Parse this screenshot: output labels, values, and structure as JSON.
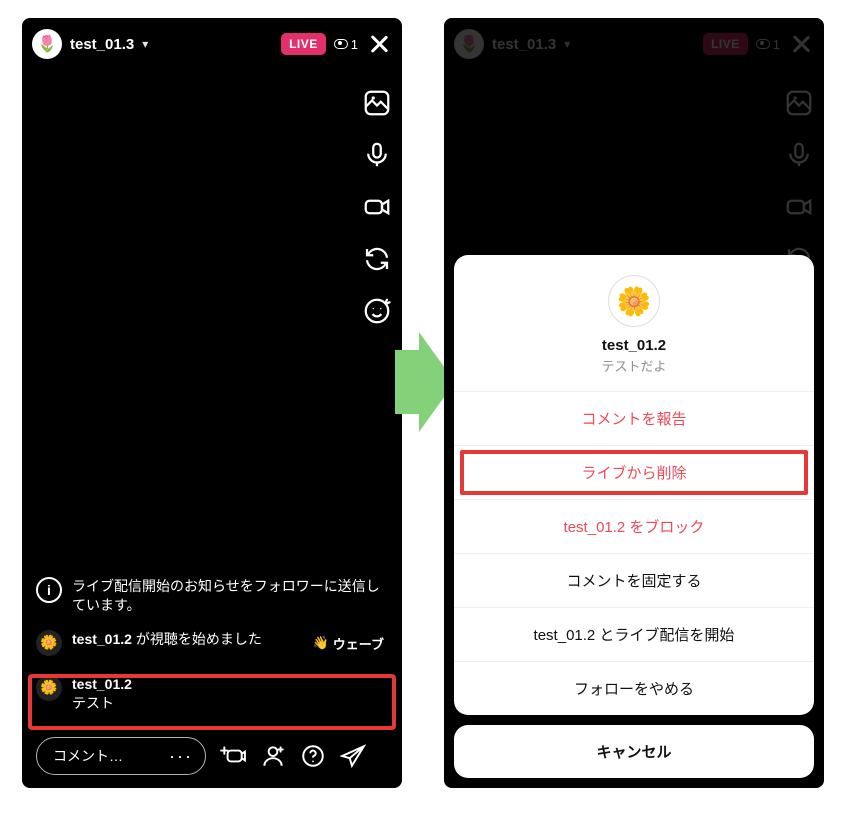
{
  "left": {
    "username": "test_01.3",
    "live_label": "LIVE",
    "viewer_count": "1",
    "notice": "ライブ配信開始のお知らせをフォロワーに送信しています。",
    "join_user": "test_01.2",
    "join_suffix": " が視聴を始めました",
    "wave_label": "ウェーブ",
    "comment_user": "test_01.2",
    "comment_text": "テスト",
    "comment_placeholder": "コメント…"
  },
  "right": {
    "username": "test_01.3",
    "live_label": "LIVE",
    "viewer_count": "1",
    "sheet": {
      "user": "test_01.2",
      "subtitle": "テストだよ",
      "options": [
        {
          "label": "コメントを報告",
          "destructive": true
        },
        {
          "label": "ライブから削除",
          "destructive": true,
          "highlighted": true
        },
        {
          "label": "test_01.2 をブロック",
          "destructive": true
        },
        {
          "label": "コメントを固定する",
          "destructive": false
        },
        {
          "label": "test_01.2 とライブ配信を開始",
          "destructive": false
        },
        {
          "label": "フォローをやめる",
          "destructive": false
        }
      ],
      "cancel": "キャンセル"
    }
  }
}
